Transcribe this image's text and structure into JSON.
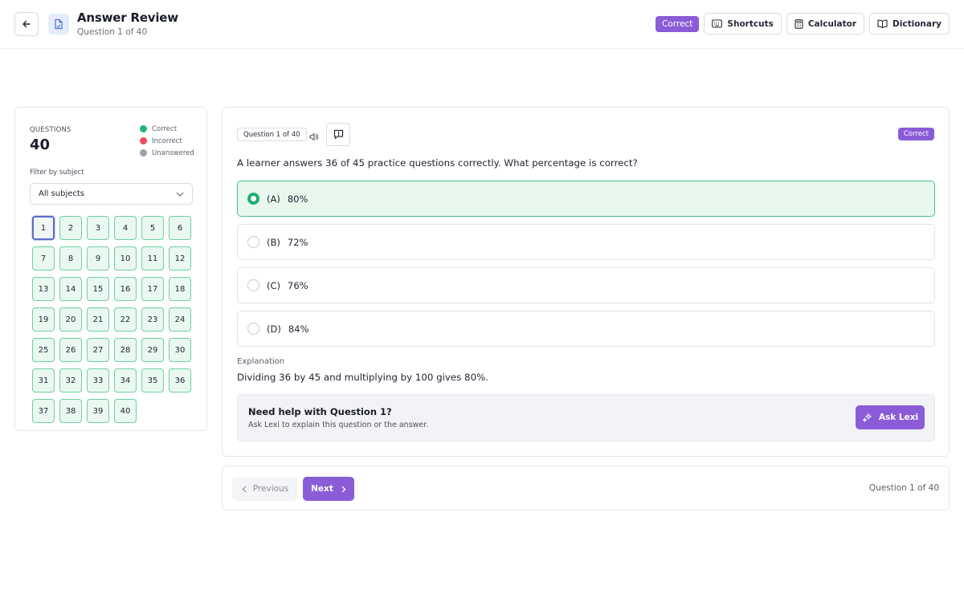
{
  "header": {
    "title": "Answer Review",
    "subtitle": "Question 1 of 40",
    "status_pill": "Correct",
    "tools": [
      {
        "label": "Shortcuts",
        "icon": "keyboard-icon"
      },
      {
        "label": "Calculator",
        "icon": "calculator-icon"
      },
      {
        "label": "Dictionary",
        "icon": "book-icon"
      }
    ]
  },
  "sidebar": {
    "questions_label": "QUESTIONS",
    "questions_count": "40",
    "legend": [
      {
        "label": "Correct",
        "color": "#22b573"
      },
      {
        "label": "Incorrect",
        "color": "#ef4b5c"
      },
      {
        "label": "Unanswered",
        "color": "#9aa0b0"
      }
    ],
    "filter_label": "Filter by subject",
    "filter_value": "All subjects",
    "current_question": "1",
    "question_numbers": [
      "1",
      "2",
      "3",
      "4",
      "5",
      "6",
      "7",
      "8",
      "9",
      "10",
      "11",
      "12",
      "13",
      "14",
      "15",
      "16",
      "17",
      "18",
      "19",
      "20",
      "21",
      "22",
      "23",
      "24",
      "25",
      "26",
      "27",
      "28",
      "29",
      "30",
      "31",
      "32",
      "33",
      "34",
      "35",
      "36",
      "37",
      "38",
      "39",
      "40"
    ]
  },
  "question": {
    "tag": "Question 1 of 40",
    "status": "Correct",
    "text": "A learner answers 36 of 45 practice questions correctly. What percentage is correct?",
    "options": [
      {
        "letter": "(A)",
        "text": "80%",
        "selected": true
      },
      {
        "letter": "(B)",
        "text": "72%",
        "selected": false
      },
      {
        "letter": "(C)",
        "text": "76%",
        "selected": false
      },
      {
        "letter": "(D)",
        "text": "84%",
        "selected": false
      }
    ],
    "explanation_label": "Explanation",
    "explanation_text": "Dividing 36 by 45 and multiplying by 100 gives 80%."
  },
  "help": {
    "title": "Need help with Question 1?",
    "subtitle": "Ask Lexi to explain this question or the answer.",
    "button": "Ask Lexi"
  },
  "navigation": {
    "previous": "Previous",
    "next": "Next",
    "status": "Question 1 of 40"
  },
  "colors": {
    "accent": "#8a5cd8",
    "correct": "#22b573"
  }
}
